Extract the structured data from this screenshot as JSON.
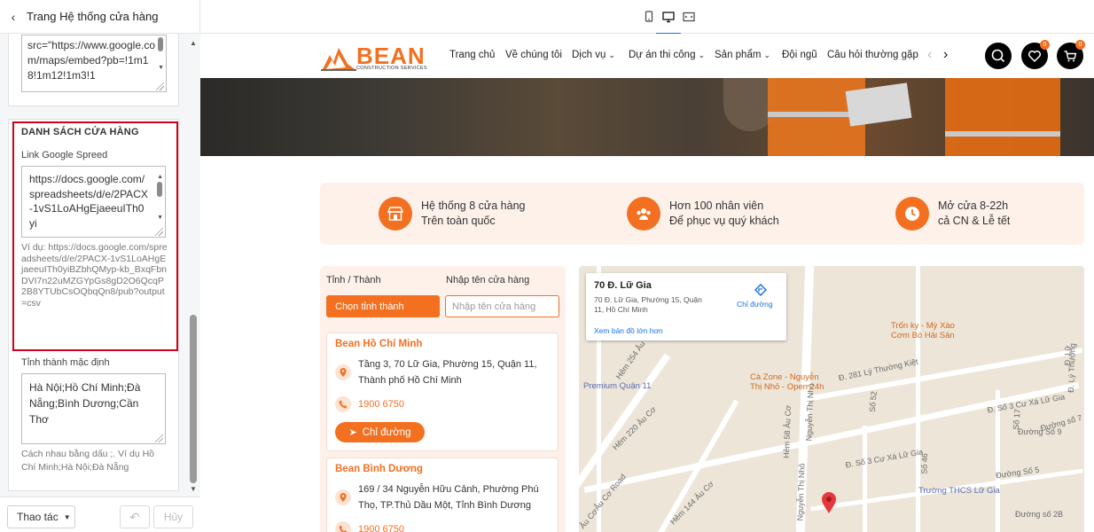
{
  "left_panel": {
    "title": "Trang Hệ thống cửa hàng",
    "iframe_text": "src=\"https://www.google.com/maps/embed?pb=!1m18!1m12!1m3!1",
    "section_title": "DANH SÁCH CỬA HÀNG",
    "link_label": "Link Google Spreed",
    "link_value": "https://docs.google.com/spreadsheets/d/e/2PACX-1vS1LoAHgEjaeeuITh0yi",
    "example": "Ví dụ: https://docs.google.com/spreadsheets/d/e/2PACX-1vS1LoAHgEjaeeuITh0yiBZbhQMyp-kb_BxqFbnDVI7n22uMZGYpGs8gD2O6QcqP2B8YTUbCsOQbqQn8/pub?output=csv",
    "default_label": "Tỉnh thành mặc định",
    "default_value": "Hà Nội;Hồ Chí Minh;Đà Nẵng;Bình Dương;Cần Thơ",
    "default_hint": "Cách nhau bằng dấu ;. Ví dụ Hồ Chí Minh;Hà Nội;Đà Nẵng",
    "action_button": "Thao tác",
    "undo_icon": "undo-icon",
    "cancel_button": "Hủy"
  },
  "device_bar": {
    "devices": [
      "mobile-icon",
      "desktop-icon",
      "fullscreen-icon"
    ],
    "active": "desktop-icon",
    "accent": "#1a73e8"
  },
  "site": {
    "logo_text": "BEAN",
    "logo_sub": "CONSTRUCTION SERVICES",
    "menu": [
      {
        "label": "Trang chủ"
      },
      {
        "label": "Về chúng tôi"
      },
      {
        "label": "Dịch vụ"
      },
      {
        "label": "Dự án thi công"
      },
      {
        "label": "Sản phẩm"
      },
      {
        "label": "Đội ngũ"
      },
      {
        "label": "Câu hỏi thường gặp"
      }
    ],
    "wishlist_count": "0",
    "cart_count": "0",
    "brand_color": "#f37021",
    "features": [
      {
        "line1": "Hệ thống 8 cửa hàng",
        "line2": "Trên toàn quốc",
        "icon": "store-icon"
      },
      {
        "line1": "Hơn 100 nhân viên",
        "line2": "Để phục vụ quý khách",
        "icon": "people-icon"
      },
      {
        "line1": "Mở cửa 8-22h",
        "line2": "cả CN & Lễ tết",
        "icon": "clock-icon"
      }
    ],
    "filter": {
      "province_label": "Tỉnh / Thành",
      "province_button": "Chọn tỉnh thành",
      "store_label": "Nhập tên cửa hàng",
      "store_placeholder": "Nhập tên cửa hàng"
    },
    "stores": [
      {
        "name": "Bean Hồ Chí Minh",
        "address": "Tầng 3, 70 Lữ Gia, Phường 15, Quận 11, Thành phố Hồ Chí Minh",
        "phone": "1900 6750",
        "direction": "Chỉ đường"
      },
      {
        "name": "Bean Bình Dương",
        "address": "169 / 34 Nguyễn Hữu Cảnh, Phường Phú Thọ, TP.Thủ Dầu Một, Tỉnh Bình Dương",
        "phone": "1900 6750",
        "direction": "Chỉ đường"
      }
    ],
    "map": {
      "card_title": "70 Đ. Lữ Gia",
      "card_address": "70 Đ. Lữ Gia, Phường 15, Quận 11, Hồ Chí Minh",
      "card_direction": "Chỉ đường",
      "card_link": "Xem bản đồ lớn hơn",
      "pois": {
        "food": "Trốn ky - Mỳ Xào Cơm Bò Hải Sản",
        "cafe": "Cà Zone - Nguyễn Thị Nhỏ - Open 24h",
        "premium": "Premium Quận 11",
        "school": "Trường THCS Lữ Gia"
      },
      "streets": {
        "s1": "Hẻm 254 Âu Cơ",
        "s2": "Đ. 281 Lý Thường Kiệt",
        "s3": "Đ. Số 3 Cư Xá Lữ Gia",
        "s4": "Nguyễn Thị Nhỏ",
        "s5": "Số 52",
        "s6": "Hẻm 58 Âu Cơ",
        "s7": "Hẻm 220 Âu Cơ",
        "s8": "Đường Số 5",
        "s9": "Đường số 2B",
        "s10": "Đ. Số 3 Cư Xá Lữ Gia",
        "s11": "Hẻm 144 Âu Cơ",
        "s12": "Âu Cơ",
        "s13": "Âu Cơ Road",
        "s14": "Nguyễn Thị Nhỏ",
        "s15": "Đ. Lý Thường",
        "s16": "Số 46",
        "s17": "Số 17",
        "s18": "Đường số 7",
        "s19": "Đường Số 9",
        "s20": "Đ. Lữ"
      }
    }
  }
}
